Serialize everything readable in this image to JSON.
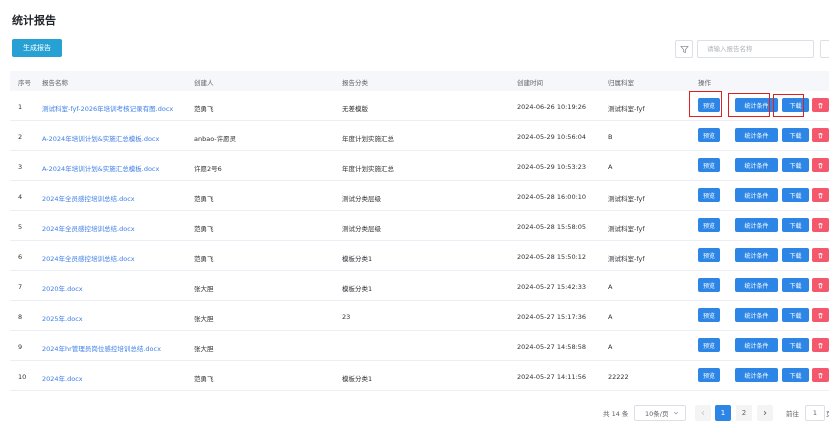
{
  "page_title": "统计报告",
  "toolbar": {
    "generate_label": "生成报告",
    "search_placeholder": "请输入报告名称"
  },
  "table": {
    "headers": {
      "index": "序号",
      "name": "报告名称",
      "creator": "创建人",
      "category": "报告分类",
      "created": "创建时间",
      "room": "归属科室",
      "actions": "操作"
    },
    "actions": {
      "preview": "预览",
      "stats": "统计条件",
      "download": "下载",
      "delete": "删除"
    },
    "rows": [
      {
        "index": "1",
        "name": "测试科室-fyf-2026年培训考核记录有图.docx",
        "creator": "范勇飞",
        "category": "无差模版",
        "created": "2024-06-26 10:19:26",
        "room": "测试科室-fyf"
      },
      {
        "index": "2",
        "name": "A-2024年培训计划&实施汇总模板.docx",
        "creator": "anbao-许愿灵",
        "category": "年度计划实施汇总",
        "created": "2024-05-29 10:56:04",
        "room": "B"
      },
      {
        "index": "3",
        "name": "A-2024年培训计划&实施汇总模板.docx",
        "creator": "许愿2号6",
        "category": "年度计划实施汇总",
        "created": "2024-05-29 10:53:23",
        "room": "A"
      },
      {
        "index": "4",
        "name": "2024年全员感控培训总结.docx",
        "creator": "范勇飞",
        "category": "测试分类层级",
        "created": "2024-05-28 16:00:10",
        "room": "测试科室-fyf"
      },
      {
        "index": "5",
        "name": "2024年全员感控培训总结.docx",
        "creator": "范勇飞",
        "category": "测试分类层级",
        "created": "2024-05-28 15:58:05",
        "room": "测试科室-fyf"
      },
      {
        "index": "6",
        "name": "2024年全员感控培训总结.docx",
        "creator": "范勇飞",
        "category": "模板分类1",
        "created": "2024-05-28 15:50:12",
        "room": "测试科室-fyf"
      },
      {
        "index": "7",
        "name": "2020年.docx",
        "creator": "张大胆",
        "category": "模板分类1",
        "created": "2024-05-27 15:42:33",
        "room": "A"
      },
      {
        "index": "8",
        "name": "2025年.docx",
        "creator": "张大胆",
        "category": "23",
        "created": "2024-05-27 15:17:36",
        "room": "A"
      },
      {
        "index": "9",
        "name": "2024年hr管理员岗位感控培训总结.docx",
        "creator": "张大胆",
        "category": "",
        "created": "2024-05-27 14:58:58",
        "room": "A"
      },
      {
        "index": "10",
        "name": "2024年.docx",
        "creator": "范勇飞",
        "category": "模板分类1",
        "created": "2024-05-27 14:11:56",
        "room": "22222"
      }
    ]
  },
  "pagination": {
    "total": "共 14 条",
    "page_size": "10条/页",
    "pages": [
      "1",
      "2"
    ],
    "current": 1,
    "goto_label": "前往",
    "goto_value": "1",
    "goto_suffix": "页"
  },
  "colors": {
    "primary": "#2d86e6",
    "teal": "#27a0d4",
    "danger": "#f5576c",
    "link": "#3d7ee5",
    "highlight": "#e02020"
  }
}
